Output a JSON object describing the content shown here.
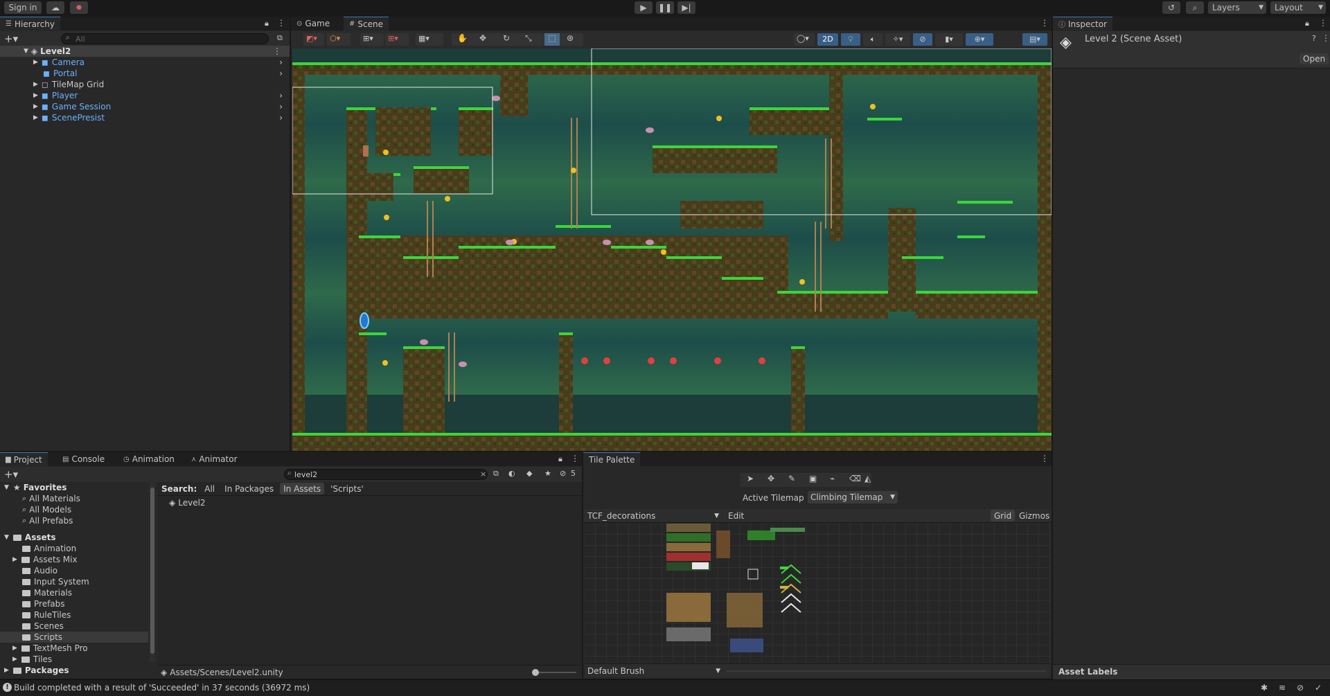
{
  "toolbar": {
    "sign_in": "Sign in",
    "layers": "Layers",
    "layout": "Layout"
  },
  "hierarchy": {
    "tab": "Hierarchy",
    "search_placeholder": "All",
    "scene": "Level2",
    "items": [
      {
        "label": "Camera"
      },
      {
        "label": "Portal"
      },
      {
        "label": "TileMap Grid"
      },
      {
        "label": "Player"
      },
      {
        "label": "Game Session"
      },
      {
        "label": "ScenePresist"
      }
    ]
  },
  "view": {
    "tab_game": "Game",
    "tab_scene": "Scene",
    "mode_2d": "2D"
  },
  "inspector": {
    "tab": "Inspector",
    "title": "Level 2 (Scene Asset)",
    "open": "Open",
    "asset_labels": "Asset Labels"
  },
  "project": {
    "tab_project": "Project",
    "tab_console": "Console",
    "tab_animation": "Animation",
    "tab_animator": "Animator",
    "search_value": "level2",
    "search_label": "Search:",
    "filters": [
      "All",
      "In Packages",
      "In Assets",
      "'Scripts'"
    ],
    "hidden_count": "5",
    "favorites": "Favorites",
    "fav_items": [
      "All Materials",
      "All Models",
      "All Prefabs"
    ],
    "assets": "Assets",
    "asset_folders": [
      "Animation",
      "Assets Mix",
      "Audio",
      "Input System",
      "Materials",
      "Prefabs",
      "RuleTiles",
      "Scenes",
      "Scripts",
      "TextMesh Pro",
      "Tiles"
    ],
    "packages": "Packages",
    "result": "Level2",
    "path": "Assets/Scenes/Level2.unity"
  },
  "palette": {
    "tab": "Tile Palette",
    "active_tilemap_label": "Active Tilemap",
    "active_tilemap_value": "Climbing Tilemap",
    "palette_name": "TCF_decorations",
    "edit": "Edit",
    "grid": "Grid",
    "gizmos": "Gizmos",
    "brush": "Default Brush"
  },
  "status": {
    "message": "Build completed with a result of 'Succeeded' in 37 seconds (36972 ms)"
  },
  "colors": {
    "accent": "#3a79bb",
    "link_blue": "#6bb0ff",
    "grass": "#3bd63b",
    "dirt": "#4a3b1d",
    "cave": "#1f5a50"
  }
}
